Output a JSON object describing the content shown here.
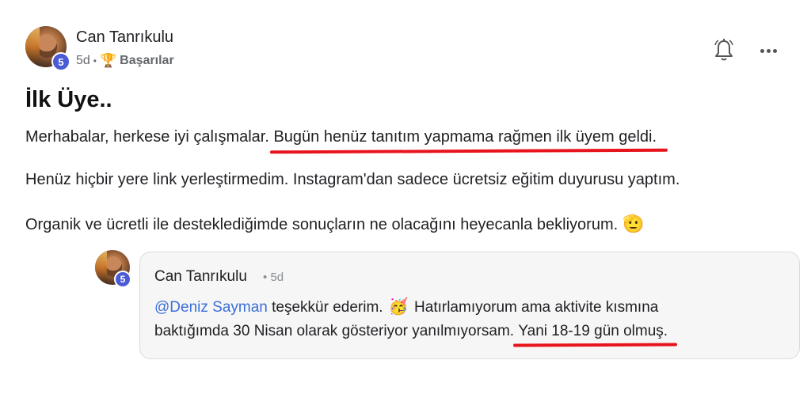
{
  "post": {
    "author": "Can Tanrıkulu",
    "level": "5",
    "time": "5d",
    "separator": "•",
    "category": "Başarılar",
    "category_icon": "trophy-icon",
    "title": "İlk Üye..",
    "paragraphs": {
      "p1_plain": "Merhabalar, herkese iyi çalışmalar. ",
      "p1_highlight": "Bugün henüz tanıtım yapmama rağmen ilk üyem geldi.",
      "p2": "Henüz hiçbir yere link yerleştirmedim. Instagram'dan sadece ücretsiz eğitim duyurusu yaptım.",
      "p3": "Organik ve ücretli ile desteklediğimde sonuçların ne olacağını heyecanla bekliyorum.",
      "p3_emoji": "🫡"
    }
  },
  "reply": {
    "author": "Can Tanrıkulu",
    "level": "5",
    "separator": "•",
    "time": "5d",
    "mention": "@Deniz Sayman",
    "line1_text": " teşekkür ederim. ",
    "line1_emoji": "🥳",
    "line1_rest": " Hatırlamıyorum ama aktivite kısmına",
    "line2_plain": "baktığımda 30 Nisan olarak gösteriyor yanılmıyorsam. ",
    "line2_highlight": "Yani 18-19 gün olmuş."
  },
  "colors": {
    "highlight_underline": "#e8141d",
    "level_badge": "#4a5bd4",
    "mention": "#3b6fd9"
  }
}
